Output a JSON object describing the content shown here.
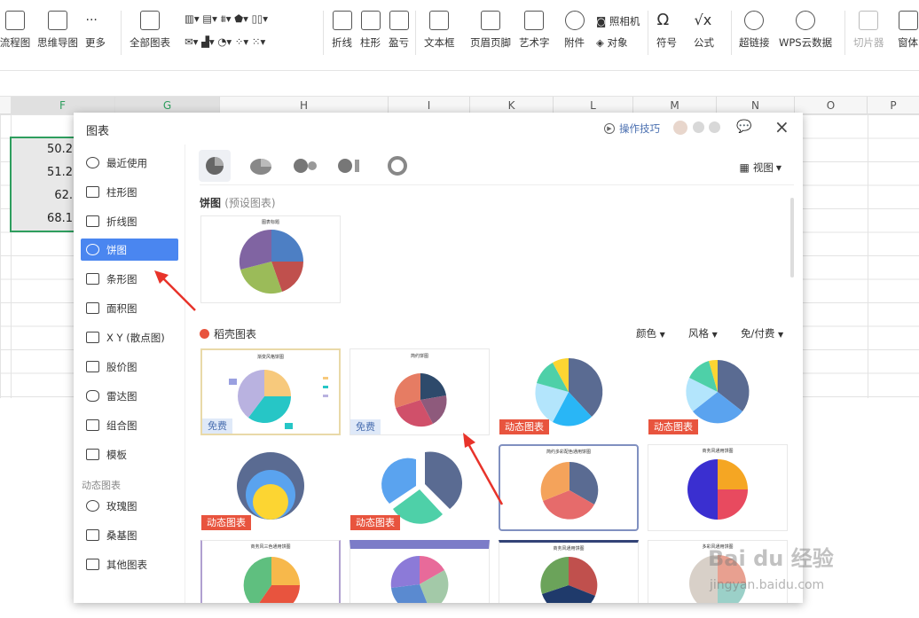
{
  "toolbar": {
    "flowchart": "流程图",
    "mindmap": "思维导图",
    "more": "更多",
    "all_charts": "全部图表",
    "line": "折线",
    "bar": "柱形",
    "winloss": "盈亏",
    "textbox": "文本框",
    "header_footer": "页眉页脚",
    "wordart": "艺术字",
    "attachment": "附件",
    "camera": "照相机",
    "object": "对象",
    "symbol": "符号",
    "formula": "公式",
    "hyperlink": "超链接",
    "wps_cloud": "WPS云数据",
    "slicer": "切片器",
    "form": "窗体"
  },
  "sheet": {
    "columns": [
      "F",
      "G",
      "H",
      "I",
      "K",
      "L",
      "M",
      "N",
      "O",
      "P"
    ],
    "cells": [
      "50.2",
      "51.2",
      "62.",
      "68.1"
    ]
  },
  "dialog": {
    "title": "图表",
    "tips": "操作技巧",
    "sidebar": [
      "最近使用",
      "柱形图",
      "折线图",
      "饼图",
      "条形图",
      "面积图",
      "X Y (散点图)",
      "股价图",
      "雷达图",
      "组合图",
      "模板"
    ],
    "dynamic_header": "动态图表",
    "dynamic_items": [
      "玫瑰图",
      "桑基图",
      "其他图表"
    ],
    "view": "视图",
    "preset_title": "饼图",
    "preset_sub": "(预设图表)",
    "preset_card_title": "图表标题",
    "daoke_title": "稻壳图表",
    "filters": [
      "颜色",
      "风格",
      "免/付费"
    ],
    "badge_free": "免费",
    "badge_dynamic": "动态图表",
    "card_titles": [
      "渐变风格饼图",
      "简约饼图",
      "",
      "",
      "",
      "",
      "简约多彩配色通用饼图",
      "商务风通用饼图",
      "商务风三色通用饼图",
      "商务风通用饼图",
      "商务风通用饼图",
      "多彩风通用饼图"
    ]
  },
  "watermark": {
    "brand": "Bai du 经验",
    "url": "jingyan.baidu.com"
  },
  "colors": {
    "accent": "#4a86f0",
    "badge_dynamic": "#e8543e",
    "selection": "#2e9e5e",
    "arrow": "#e8332a"
  }
}
